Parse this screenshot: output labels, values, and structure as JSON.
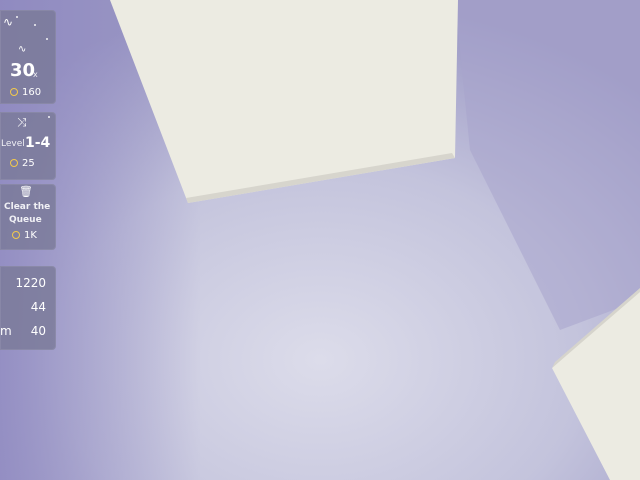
{
  "hud": {
    "speed": {
      "icon": "speed-wave-icon",
      "value": "30",
      "unit": "x",
      "cost": "160"
    },
    "level": {
      "icon": "shuffle-icon",
      "label": "Level",
      "value": "1-4",
      "cost": "25"
    },
    "queue": {
      "icon": "trash-icon",
      "label_line1": "Clear the",
      "label_line2": "Queue",
      "cost": "1K"
    },
    "stats": [
      {
        "label": "",
        "value": "1220"
      },
      {
        "label": "",
        "value": "44"
      },
      {
        "label": "m",
        "value": "40"
      }
    ]
  },
  "colors": {
    "panel": "#7878968f",
    "coin": "#f2c94c",
    "floor": "#c9c9df",
    "wall": "#ecebe2"
  }
}
